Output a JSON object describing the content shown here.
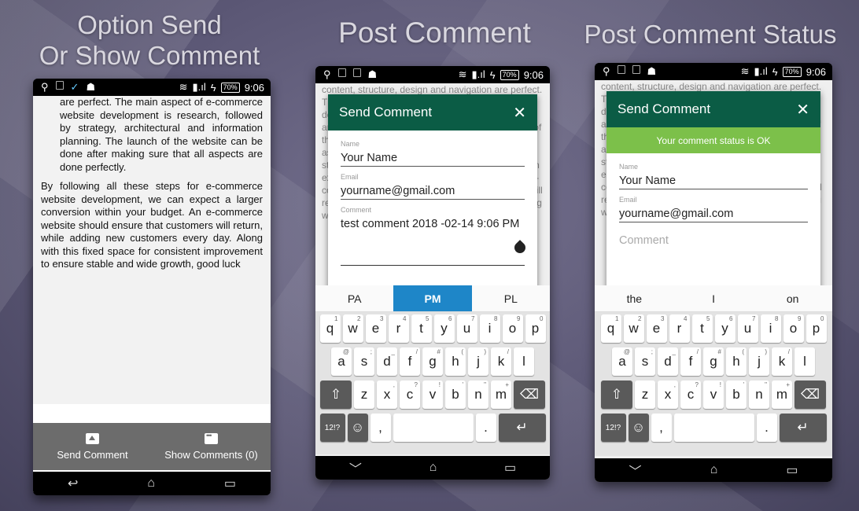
{
  "titles": {
    "left_line1": "Option Send",
    "left_line2": "Or Show Comment",
    "middle": "Post Comment",
    "right": "Post Comment Status"
  },
  "status": {
    "time": "9:06",
    "battery": "70%"
  },
  "article": {
    "p1": "are perfect. The main aspect of e-commerce website development is research, followed by strategy, architectural and information planning. The launch of the website can be done after making sure that all aspects are done perfectly.",
    "p2": "By following all these steps for e-commerce website development, we can expect a larger conversion within your budget. An e-commerce website should ensure that customers will return, while adding new customers every day. Along with this fixed space for consistent improvement to ensure stable and wide growth, good luck"
  },
  "actions": {
    "send": "Send Comment",
    "show": "Show Comments (0)"
  },
  "background_text": "content, structure, design and navigation are perfect. The main aspect of e-commerce website development is research, followed by strategy, architectural and information planning. The launch of the website can be done after making sure that all aspects are done perfectly. By following all these steps for e-commerce website development, we can expect a larger conversion within your budget. An e-commerce website should ensure that customers will return, while adding new customers every day. Along with this fixed space for consistent improvement.",
  "dialog": {
    "title": "Send Comment",
    "close": "✕",
    "status_ok": "Your comment status is OK"
  },
  "form": {
    "name_label": "Name",
    "name_value": "Your Name",
    "email_label": "Email",
    "email_value": "yourname@gmail.com",
    "comment_label": "Comment",
    "comment_value": "test comment 2018 -02-14 9:06 PM",
    "comment_placeholder": "Comment"
  },
  "keyboard": {
    "suggestions_mid": [
      "PA",
      "PM",
      "PL"
    ],
    "suggestions_right": [
      "the",
      "I",
      "on"
    ],
    "row1": [
      "q",
      "w",
      "e",
      "r",
      "t",
      "y",
      "u",
      "i",
      "o",
      "p"
    ],
    "row1_sup": [
      "1",
      "2",
      "3",
      "4",
      "5",
      "6",
      "7",
      "8",
      "9",
      "0"
    ],
    "row2": [
      "a",
      "s",
      "d",
      "f",
      "g",
      "h",
      "j",
      "k",
      "l"
    ],
    "row2_sup": [
      "@",
      ";",
      "_",
      "/",
      "#",
      "(",
      ")",
      "/",
      ""
    ],
    "row3": [
      "z",
      "x",
      "c",
      "v",
      "b",
      "n",
      "m"
    ],
    "row3_sup": [
      "",
      ",",
      "?",
      "!",
      "'",
      "\"",
      "+"
    ],
    "shift": "⇧",
    "backspace": "⌫",
    "symbols": "12!?",
    "emoji": "☺",
    "comma": ",",
    "period": ".",
    "enter": "↵"
  },
  "nav": {
    "back": "↩",
    "home": "⌂",
    "recent": "▭"
  }
}
